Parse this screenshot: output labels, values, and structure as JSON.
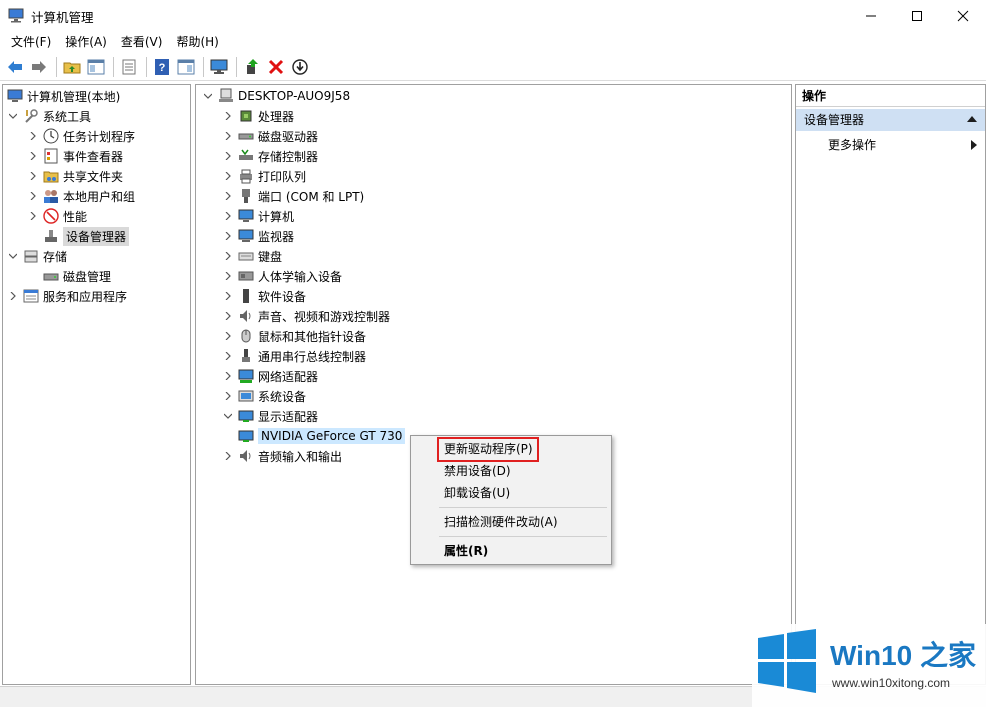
{
  "window": {
    "title": "计算机管理",
    "controls": [
      "minimize",
      "maximize",
      "close"
    ]
  },
  "menu": [
    "文件(F)",
    "操作(A)",
    "查看(V)",
    "帮助(H)"
  ],
  "left_tree": {
    "root": "计算机管理(本地)",
    "system_tools": "系统工具",
    "task_scheduler": "任务计划程序",
    "event_viewer": "事件查看器",
    "shared_folders": "共享文件夹",
    "local_users": "本地用户和组",
    "performance": "性能",
    "device_manager": "设备管理器",
    "storage": "存储",
    "disk_management": "磁盘管理",
    "services": "服务和应用程序"
  },
  "device_tree": {
    "root": "DESKTOP-AUO9J58",
    "categories": [
      "处理器",
      "磁盘驱动器",
      "存储控制器",
      "打印队列",
      "端口 (COM 和 LPT)",
      "计算机",
      "监视器",
      "键盘",
      "人体学输入设备",
      "软件设备",
      "声音、视频和游戏控制器",
      "鼠标和其他指针设备",
      "通用串行总线控制器",
      "网络适配器",
      "系统设备",
      "显示适配器"
    ],
    "display_child": "NVIDIA GeForce GT 730",
    "audio_io": "音频输入和输出"
  },
  "actions": {
    "header": "操作",
    "group": "设备管理器",
    "more": "更多操作"
  },
  "context_menu": {
    "update_driver": "更新驱动程序(P)",
    "disable": "禁用设备(D)",
    "uninstall": "卸载设备(U)",
    "scan": "扫描检测硬件改动(A)",
    "properties": "属性(R)"
  },
  "watermark": {
    "brand": "Win10 之家",
    "url": "www.win10xitong.com"
  },
  "colors": {
    "selection_blue": "#cce8ff",
    "action_group": "#cfe0f3",
    "highlight_red": "#e02020",
    "brand_blue": "#1a78c2"
  }
}
